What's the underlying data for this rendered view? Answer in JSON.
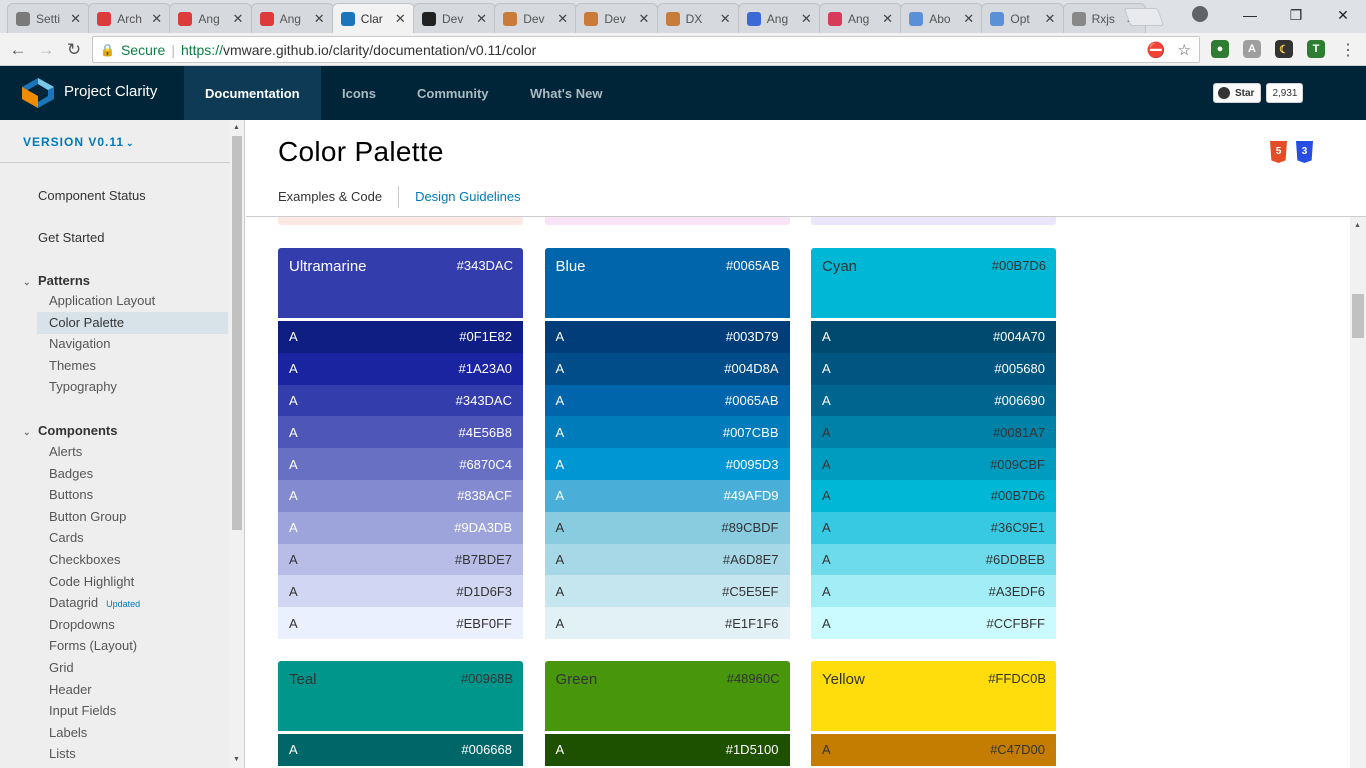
{
  "browser": {
    "tabs": [
      {
        "label": "Setti",
        "icon": "gear-icon",
        "color": "#7a7a7a"
      },
      {
        "label": "Arch",
        "icon": "angular-icon",
        "color": "#dd3b3b"
      },
      {
        "label": "Ang",
        "icon": "angular-icon",
        "color": "#dd3b3b"
      },
      {
        "label": "Ang",
        "icon": "angular-icon",
        "color": "#dd3b3b"
      },
      {
        "label": "Clar",
        "icon": "clarity-icon",
        "color": "#1b75bb",
        "active": true
      },
      {
        "label": "Dev",
        "icon": "github-icon",
        "color": "#222222"
      },
      {
        "label": "Dev",
        "icon": "stackblitz-icon",
        "color": "#c87b3a"
      },
      {
        "label": "Dev",
        "icon": "stackblitz-icon",
        "color": "#c87b3a"
      },
      {
        "label": "DX",
        "icon": "stackblitz-icon",
        "color": "#c87b3a"
      },
      {
        "label": "Ang",
        "icon": "bootstrap-icon",
        "color": "#3b6ad6"
      },
      {
        "label": "Ang",
        "icon": "bootstrap-icon",
        "color": "#d63b5a"
      },
      {
        "label": "Abo",
        "icon": "layers-icon",
        "color": "#5b8fd6"
      },
      {
        "label": "Opt",
        "icon": "layers-icon",
        "color": "#5b8fd6"
      },
      {
        "label": "Rxjs",
        "icon": "document-icon",
        "color": "#888888"
      }
    ],
    "secure_label": "Secure",
    "url_scheme": "https://",
    "url_rest": "vmware.github.io/clarity/documentation/v0.11/color"
  },
  "header": {
    "brand": "Project Clarity",
    "nav": [
      "Documentation",
      "Icons",
      "Community",
      "What's New"
    ],
    "github_star": "Star",
    "github_count": "2,931"
  },
  "sidebar": {
    "version": "VERSION V0.11",
    "top_links": [
      "Component Status",
      "Get Started"
    ],
    "patterns_title": "Patterns",
    "patterns": [
      "Application Layout",
      "Color Palette",
      "Navigation",
      "Themes",
      "Typography"
    ],
    "components_title": "Components",
    "components": [
      "Alerts",
      "Badges",
      "Buttons",
      "Button Group",
      "Cards",
      "Checkboxes",
      "Code Highlight",
      "Datagrid",
      "Dropdowns",
      "Forms (Layout)",
      "Grid",
      "Header",
      "Input Fields",
      "Labels",
      "Lists"
    ],
    "datagrid_badge": "Updated"
  },
  "content": {
    "title": "Color Palette",
    "tab_examples": "Examples & Code",
    "tab_guidelines": "Design Guidelines"
  },
  "palettes": [
    {
      "name": "Ultramarine",
      "hex": "#343DAC",
      "head_text": "#ffffff",
      "swatches": [
        {
          "hex": "#0F1E82",
          "text": "#ffffff"
        },
        {
          "hex": "#1A23A0",
          "text": "#ffffff"
        },
        {
          "hex": "#343DAC",
          "text": "#ffffff"
        },
        {
          "hex": "#4E56B8",
          "text": "#ffffff"
        },
        {
          "hex": "#6870C4",
          "text": "#ffffff"
        },
        {
          "hex": "#838ACF",
          "text": "#ffffff"
        },
        {
          "hex": "#9DA3DB",
          "text": "#ffffff"
        },
        {
          "hex": "#B7BDE7",
          "text": "#333333"
        },
        {
          "hex": "#D1D6F3",
          "text": "#333333"
        },
        {
          "hex": "#EBF0FF",
          "text": "#333333"
        }
      ]
    },
    {
      "name": "Blue",
      "hex": "#0065AB",
      "head_text": "#ffffff",
      "swatches": [
        {
          "hex": "#003D79",
          "text": "#ffffff"
        },
        {
          "hex": "#004D8A",
          "text": "#ffffff"
        },
        {
          "hex": "#0065AB",
          "text": "#ffffff"
        },
        {
          "hex": "#007CBB",
          "text": "#ffffff"
        },
        {
          "hex": "#0095D3",
          "text": "#ffffff"
        },
        {
          "hex": "#49AFD9",
          "text": "#ffffff"
        },
        {
          "hex": "#89CBDF",
          "text": "#333333"
        },
        {
          "hex": "#A6D8E7",
          "text": "#333333"
        },
        {
          "hex": "#C5E5EF",
          "text": "#333333"
        },
        {
          "hex": "#E1F1F6",
          "text": "#333333"
        }
      ]
    },
    {
      "name": "Cyan",
      "hex": "#00B7D6",
      "head_text": "#333333",
      "swatches": [
        {
          "hex": "#004A70",
          "text": "#ffffff"
        },
        {
          "hex": "#005680",
          "text": "#ffffff"
        },
        {
          "hex": "#006690",
          "text": "#ffffff"
        },
        {
          "hex": "#0081A7",
          "text": "#333333"
        },
        {
          "hex": "#009CBF",
          "text": "#333333"
        },
        {
          "hex": "#00B7D6",
          "text": "#333333"
        },
        {
          "hex": "#36C9E1",
          "text": "#333333"
        },
        {
          "hex": "#6DDBEB",
          "text": "#333333"
        },
        {
          "hex": "#A3EDF6",
          "text": "#333333"
        },
        {
          "hex": "#CCFBFF",
          "text": "#333333"
        }
      ]
    },
    {
      "name": "Teal",
      "hex": "#00968B",
      "head_text": "#333333",
      "swatches": [
        {
          "hex": "#006668",
          "text": "#ffffff"
        }
      ]
    },
    {
      "name": "Green",
      "hex": "#48960C",
      "head_text": "#333333",
      "swatches": [
        {
          "hex": "#1D5100",
          "text": "#ffffff"
        }
      ]
    },
    {
      "name": "Yellow",
      "hex": "#FFDC0B",
      "head_text": "#333333",
      "swatches": [
        {
          "hex": "#C47D00",
          "text": "#333333"
        }
      ]
    }
  ],
  "swatch_letter": "A",
  "peek_colors": [
    "#fde9e3",
    "#f9e3f7",
    "#ece6fa"
  ]
}
